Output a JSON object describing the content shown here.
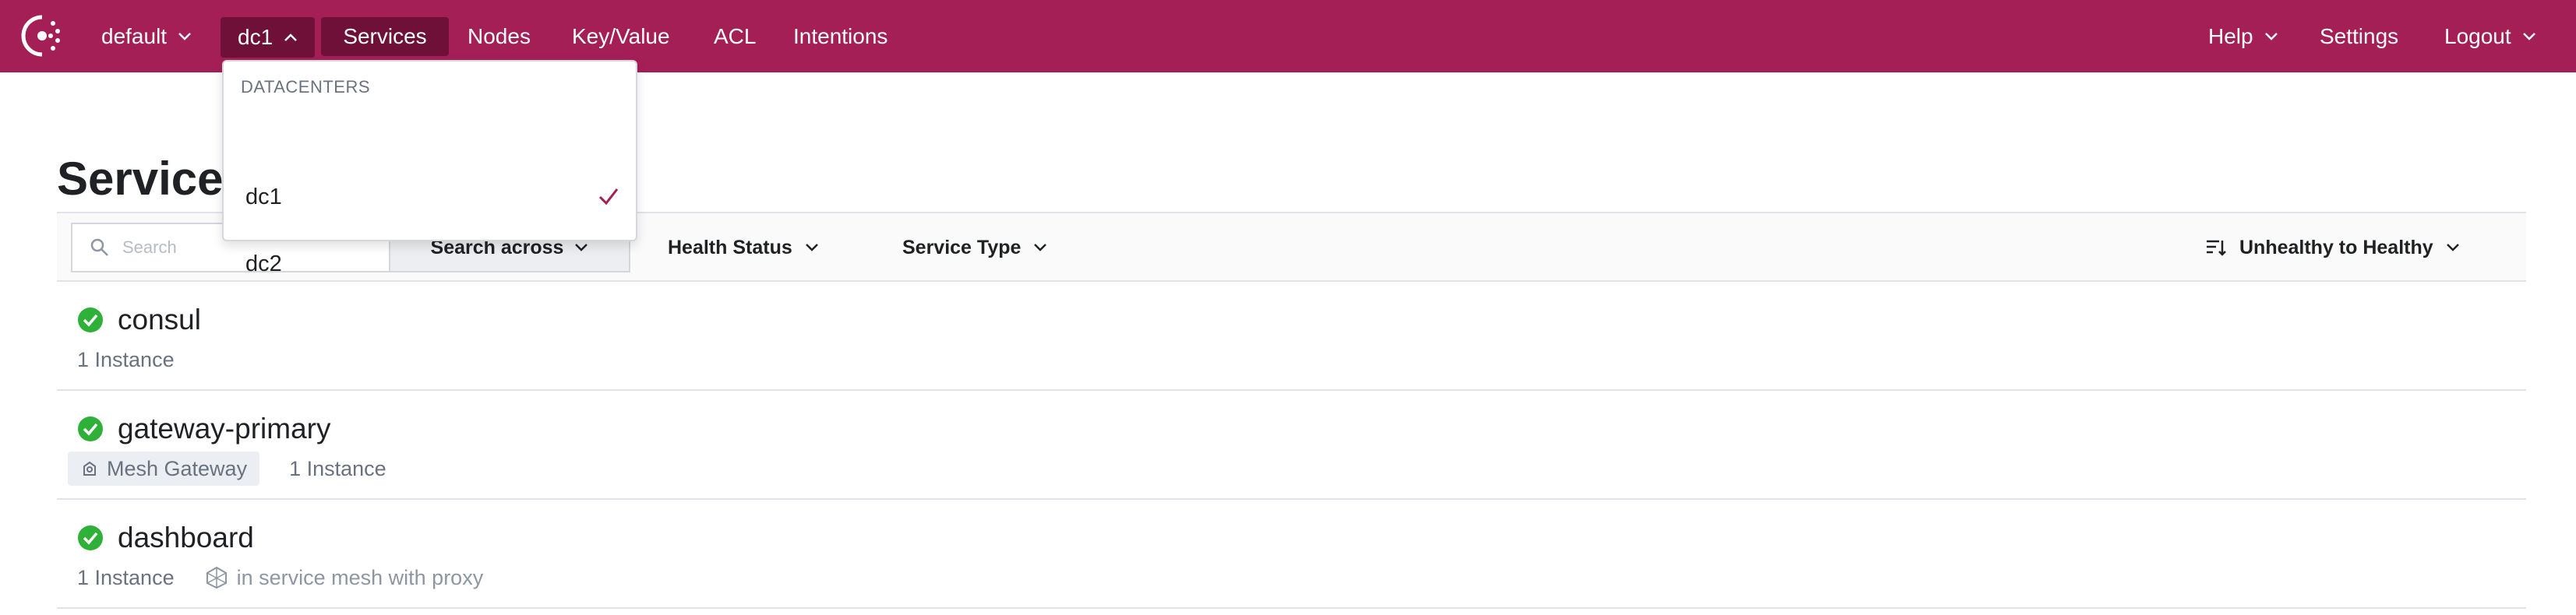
{
  "nav": {
    "namespace": "default",
    "datacenter": "dc1",
    "items": [
      "Services",
      "Nodes",
      "Key/Value",
      "ACL",
      "Intentions"
    ],
    "right": [
      "Help",
      "Settings",
      "Logout"
    ]
  },
  "datacenter_menu": {
    "header": "DATACENTERS",
    "options": [
      "dc1",
      "dc2"
    ],
    "selected": "dc1"
  },
  "page": {
    "title": "Services"
  },
  "filters": {
    "search_placeholder": "Search",
    "search_across": "Search across",
    "health_status": "Health Status",
    "service_type": "Service Type",
    "sort": "Unhealthy to Healthy"
  },
  "services": [
    {
      "name": "consul",
      "instances": "1 Instance",
      "health": "passing"
    },
    {
      "name": "gateway-primary",
      "badge": "Mesh Gateway",
      "instances": "1 Instance",
      "health": "passing"
    },
    {
      "name": "dashboard",
      "instances": "1 Instance",
      "mesh": "in service mesh with proxy",
      "health": "passing"
    }
  ],
  "colors": {
    "brand": "#a51f57",
    "nav_active": "#6f1038",
    "health_passing": "#2eb039",
    "check": "#a51f57"
  },
  "icons": {
    "logo": "consul-logo-icon",
    "search": "search-icon",
    "sort": "sort-icon",
    "health": "check-circle-icon",
    "mesh_gateway": "mesh-gateway-icon",
    "mesh": "service-mesh-icon",
    "check": "check-icon",
    "chevron": "chevron-down-icon"
  }
}
